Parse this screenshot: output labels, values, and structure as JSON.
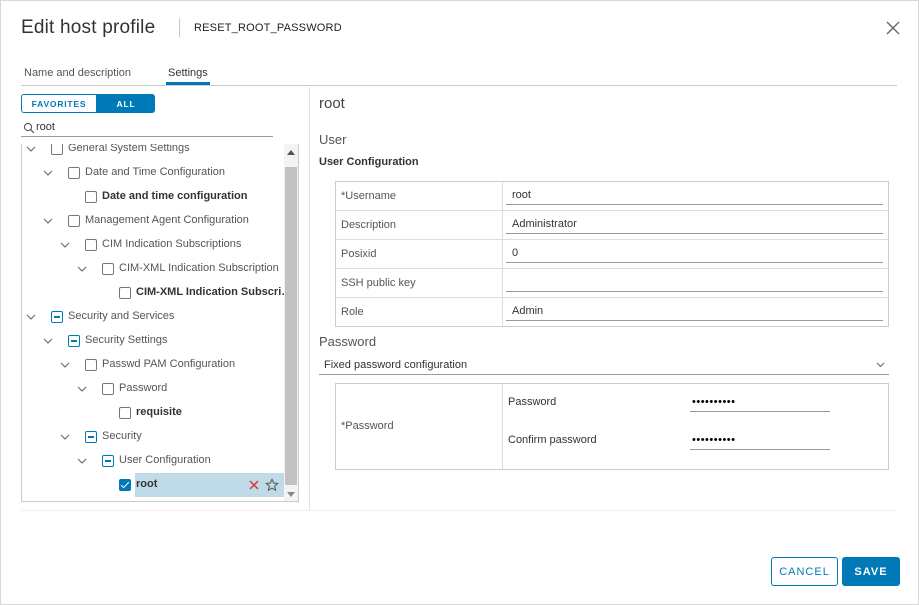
{
  "header": {
    "title": "Edit host profile",
    "subtitle": "RESET_ROOT_PASSWORD"
  },
  "tabs": [
    {
      "label": "Name and description",
      "active": false
    },
    {
      "label": "Settings",
      "active": true
    }
  ],
  "filter": {
    "favorites_label": "FAVORITES",
    "all_label": "ALL",
    "active": "ALL"
  },
  "search": {
    "value": "root"
  },
  "tree": [
    {
      "label": "General System Settings",
      "state": "unchecked",
      "expanded": true,
      "bold": false
    },
    {
      "label": "Date and Time Configuration",
      "state": "unchecked",
      "expanded": true,
      "bold": false
    },
    {
      "label": "Date and time configuration",
      "state": "unchecked",
      "expanded": false,
      "bold": true
    },
    {
      "label": "Management Agent Configuration",
      "state": "unchecked",
      "expanded": true,
      "bold": false
    },
    {
      "label": "CIM Indication Subscriptions",
      "state": "unchecked",
      "expanded": true,
      "bold": false
    },
    {
      "label": "CIM-XML Indication Subscription",
      "state": "unchecked",
      "expanded": true,
      "bold": false
    },
    {
      "label": "CIM-XML Indication Subscri…",
      "state": "unchecked",
      "expanded": false,
      "bold": true
    },
    {
      "label": "Security and Services",
      "state": "indeterminate",
      "expanded": true,
      "bold": false
    },
    {
      "label": "Security Settings",
      "state": "indeterminate",
      "expanded": true,
      "bold": false
    },
    {
      "label": "Passwd PAM Configuration",
      "state": "unchecked",
      "expanded": true,
      "bold": false
    },
    {
      "label": "Password",
      "state": "unchecked",
      "expanded": true,
      "bold": false
    },
    {
      "label": "requisite",
      "state": "unchecked",
      "expanded": false,
      "bold": true
    },
    {
      "label": "Security",
      "state": "indeterminate",
      "expanded": true,
      "bold": false
    },
    {
      "label": "User Configuration",
      "state": "indeterminate",
      "expanded": true,
      "bold": false
    },
    {
      "label": "root",
      "state": "checked",
      "expanded": false,
      "bold": true,
      "selected": true
    }
  ],
  "detail": {
    "title": "root",
    "section_user": "User",
    "subsection": "User Configuration",
    "fields": [
      {
        "label": "*Username",
        "value": "root"
      },
      {
        "label": "Description",
        "value": "Administrator"
      },
      {
        "label": "Posixid",
        "value": "0"
      },
      {
        "label": "SSH public key",
        "value": ""
      },
      {
        "label": "Role",
        "value": "Admin"
      }
    ],
    "section_password": "Password",
    "password_mode": "Fixed password configuration",
    "password_key": "*Password",
    "password_label": "Password",
    "password_value": "••••••••••",
    "confirm_label": "Confirm password",
    "confirm_value": "••••••••••"
  },
  "footer": {
    "cancel_label": "CANCEL",
    "save_label": "SAVE"
  },
  "colors": {
    "accent": "#0079b8",
    "selection": "#bfdbe8",
    "remove": "#d9342b"
  }
}
